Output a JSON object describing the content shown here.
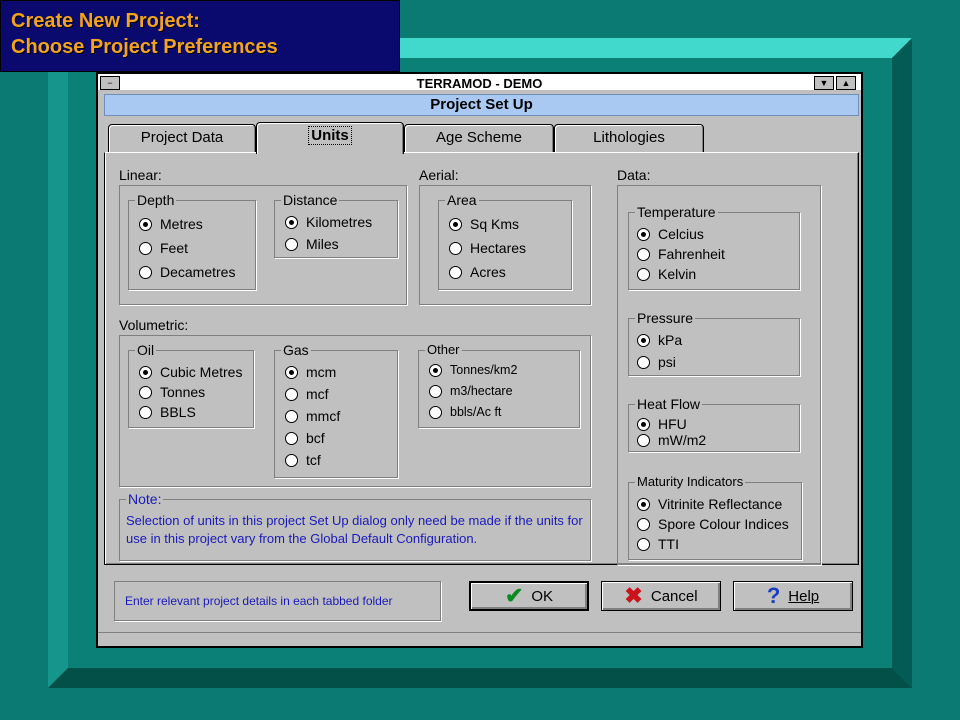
{
  "slide": {
    "title_line1": "Create New Project:",
    "title_line2": "Choose Project Preferences"
  },
  "window": {
    "title": "TERRAMOD - DEMO",
    "dialog_title": "Project Set Up"
  },
  "tabs": [
    {
      "label": "Project Data",
      "active": false
    },
    {
      "label": "Units",
      "active": true
    },
    {
      "label": "Age Scheme",
      "active": false
    },
    {
      "label": "Lithologies",
      "active": false
    }
  ],
  "units": {
    "linear_label": "Linear:",
    "depth": {
      "label": "Depth",
      "options": [
        "Metres",
        "Feet",
        "Decametres"
      ],
      "selected": "Metres"
    },
    "distance": {
      "label": "Distance",
      "options": [
        "Kilometres",
        "Miles"
      ],
      "selected": "Kilometres"
    },
    "aerial_label": "Aerial:",
    "area": {
      "label": "Area",
      "options": [
        "Sq Kms",
        "Hectares",
        "Acres"
      ],
      "selected": "Sq Kms"
    },
    "volumetric_label": "Volumetric:",
    "oil": {
      "label": "Oil",
      "options": [
        "Cubic Metres",
        "Tonnes",
        "BBLS"
      ],
      "selected": "Cubic Metres"
    },
    "gas": {
      "label": "Gas",
      "options": [
        "mcm",
        "mcf",
        "mmcf",
        "bcf",
        "tcf"
      ],
      "selected": "mcm"
    },
    "other": {
      "label": "Other",
      "options": [
        "Tonnes/km2",
        "m3/hectare",
        "bbls/Ac ft"
      ],
      "selected": "Tonnes/km2"
    },
    "data_label": "Data:",
    "temperature": {
      "label": "Temperature",
      "options": [
        "Celcius",
        "Fahrenheit",
        "Kelvin"
      ],
      "selected": "Celcius"
    },
    "pressure": {
      "label": "Pressure",
      "options": [
        "kPa",
        "psi"
      ],
      "selected": "kPa"
    },
    "heat_flow": {
      "label": "Heat Flow",
      "options": [
        "HFU",
        "mW/m2"
      ],
      "selected": "HFU"
    },
    "maturity": {
      "label": "Maturity Indicators",
      "options": [
        "Vitrinite Reflectance",
        "Spore Colour Indices",
        "TTI"
      ],
      "selected": "Vitrinite Reflectance"
    },
    "note_label": "Note:",
    "note_text": "Selection of units in this project Set Up dialog only need be made if the units for use in this project vary from the Global Default Configuration."
  },
  "footer": {
    "status_text": "Enter relevant project details in each tabbed folder",
    "ok_label": "OK",
    "cancel_label": "Cancel",
    "help_label": "Help"
  }
}
